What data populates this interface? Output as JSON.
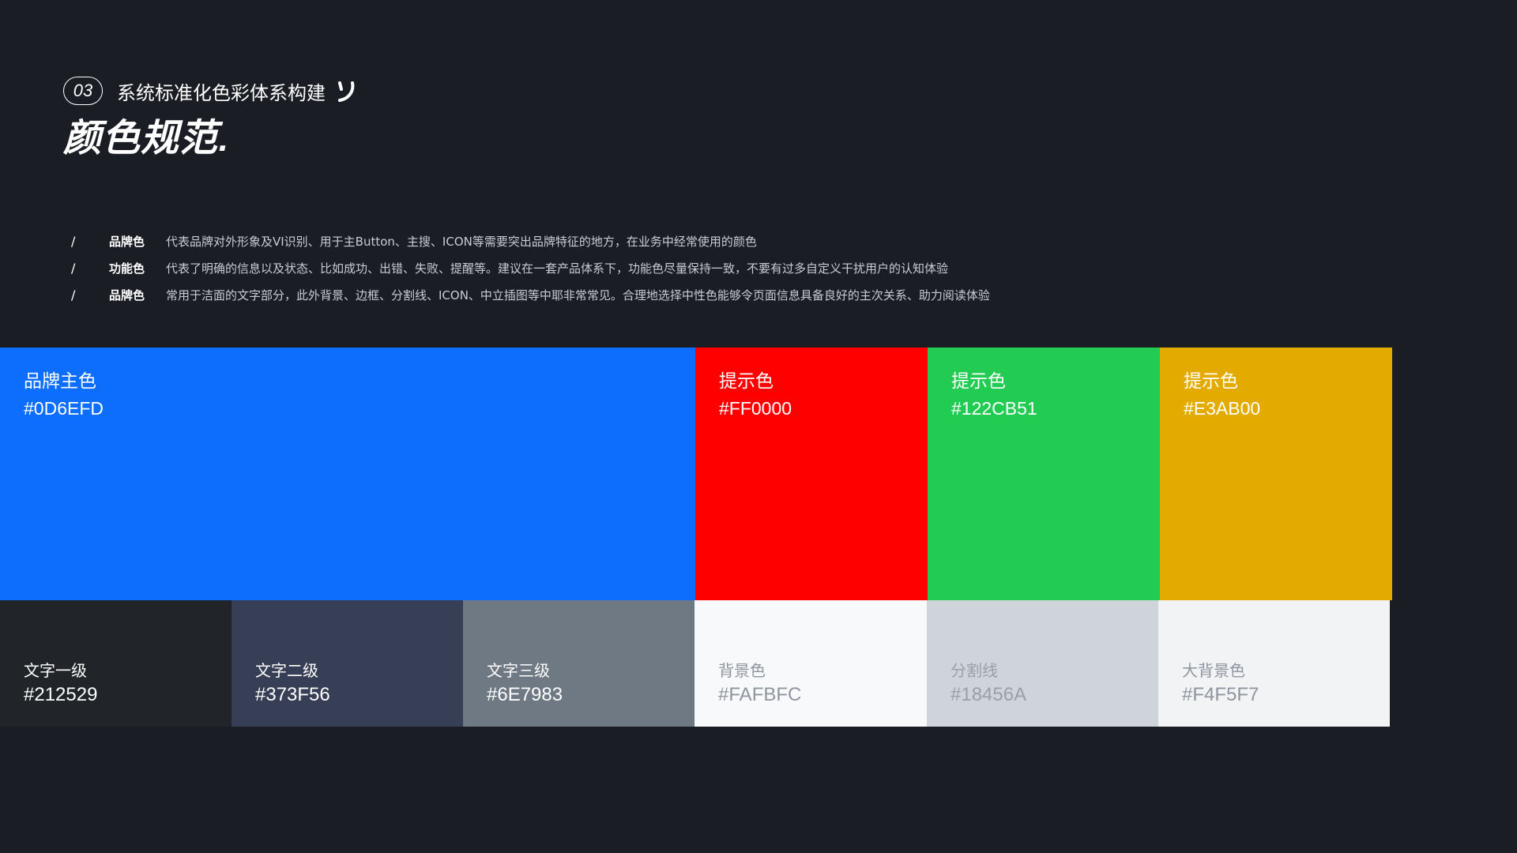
{
  "header": {
    "section_number": "03",
    "section_title": "系统标准化色彩体系构建",
    "title": "颜色规范",
    "title_suffix": "."
  },
  "descriptions": [
    {
      "slash": "/",
      "label": "品牌色",
      "text": "代表品牌对外形象及VI识别、用于主Button、主搜、ICON等需要突出品牌特征的地方，在业务中经常使用的颜色"
    },
    {
      "slash": "/",
      "label": "功能色",
      "text": "代表了明确的信息以及状态、比如成功、出错、失败、提醒等。建议在一套产品体系下，功能色尽量保持一致，不要有过多自定义干扰用户的认知体验"
    },
    {
      "slash": "/",
      "label": "品牌色",
      "text": "常用于洁面的文字部分，此外背景、边框、分割线、ICON、中立插图等中耶非常常见。合理地选择中性色能够令页面信息具备良好的主次关系、助力阅读体验"
    }
  ],
  "swatches_top": [
    {
      "name": "品牌主色",
      "code": "#0D6EFD",
      "color": "#0D6EFD",
      "text_color": "#ffffff"
    },
    {
      "name": "提示色",
      "code": "#FF0000",
      "color": "#FF0000",
      "text_color": "#ffffff"
    },
    {
      "name": "提示色",
      "code": "#122CB51",
      "color": "#22CB51",
      "text_color": "#ffffff"
    },
    {
      "name": "提示色",
      "code": "#E3AB00",
      "color": "#E3AB00",
      "text_color": "#ffffff"
    }
  ],
  "swatches_bottom": [
    {
      "name": "文字一级",
      "code": "#212529",
      "color": "#212529",
      "text_color": "#ffffff"
    },
    {
      "name": "文字二级",
      "code": "#373F56",
      "color": "#373F56",
      "text_color": "#ffffff"
    },
    {
      "name": "文字三级",
      "code": "#6E7983",
      "color": "#6E7983",
      "text_color": "#ffffff"
    },
    {
      "name": "背景色",
      "code": "#FAFBFC",
      "color": "#F8F9FA",
      "text_color": "#8f959e"
    },
    {
      "name": "分割线",
      "code": "#18456A",
      "color": "#CFD3DA",
      "text_color": "#9a9fa8"
    },
    {
      "name": "大背景色",
      "code": "#F4F5F7",
      "color": "#F2F3F5",
      "text_color": "#8f959e"
    }
  ]
}
